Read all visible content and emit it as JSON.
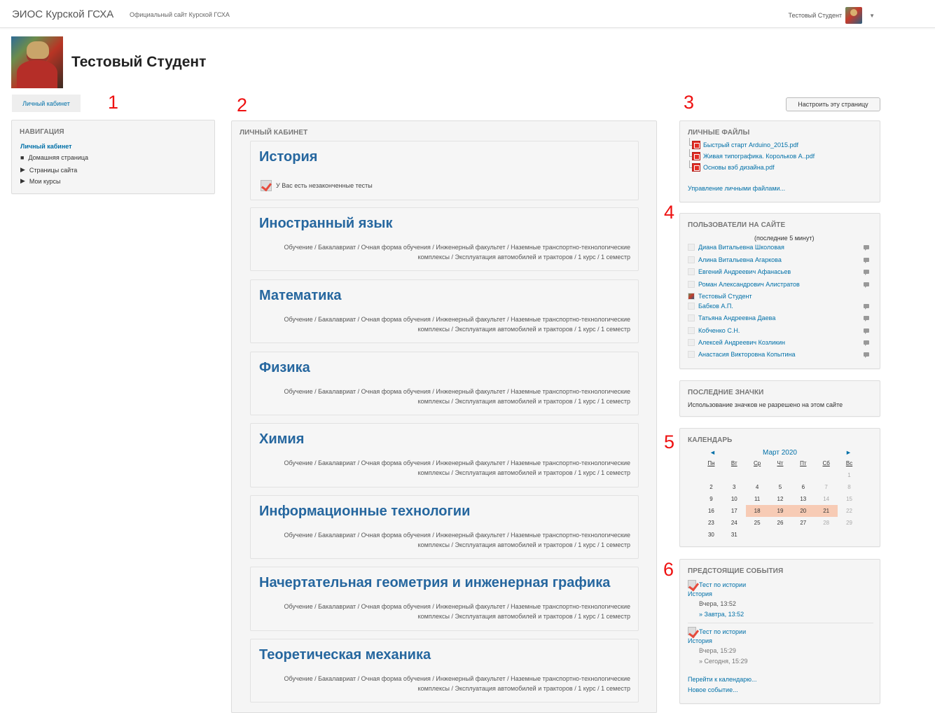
{
  "topbar": {
    "brand": "ЭИОС Курской ГСХА",
    "official_link": "Официальный сайт Курской ГСХА",
    "user_name": "Тестовый Студент"
  },
  "profile": {
    "name": "Тестовый Студент"
  },
  "markers": [
    "1",
    "2",
    "3",
    "4",
    "5",
    "6"
  ],
  "left": {
    "dashboard_tab": "Личный кабинет",
    "navigation": {
      "title": "НАВИГАЦИЯ",
      "items": [
        "Личный кабинет",
        "Домашняя страница",
        "Страницы сайта",
        "Мои курсы"
      ]
    }
  },
  "main": {
    "title": "ЛИЧНЫЙ КАБИНЕТ",
    "courses": [
      {
        "title": "История",
        "note": "У Вас есть незаконченные тесты",
        "path": ""
      },
      {
        "title": "Иностранный язык",
        "note": "",
        "path": "Обучение / Бакалавриат / Очная форма обучения / Инженерный факультет / Наземные транспортно-технологические комплексы / Эксплуатация автомобилей и тракторов / 1 курс / 1 семестр"
      },
      {
        "title": "Математика",
        "note": "",
        "path": "Обучение / Бакалавриат / Очная форма обучения / Инженерный факультет / Наземные транспортно-технологические комплексы / Эксплуатация автомобилей и тракторов / 1 курс / 1 семестр"
      },
      {
        "title": "Физика",
        "note": "",
        "path": "Обучение / Бакалавриат / Очная форма обучения / Инженерный факультет / Наземные транспортно-технологические комплексы / Эксплуатация автомобилей и тракторов / 1 курс / 1 семестр"
      },
      {
        "title": "Химия",
        "note": "",
        "path": "Обучение / Бакалавриат / Очная форма обучения / Инженерный факультет / Наземные транспортно-технологические комплексы / Эксплуатация автомобилей и тракторов / 1 курс / 1 семестр"
      },
      {
        "title": "Информационные технологии",
        "note": "",
        "path": "Обучение / Бакалавриат / Очная форма обучения / Инженерный факультет / Наземные транспортно-технологические комплексы / Эксплуатация автомобилей и тракторов / 1 курс / 1 семестр"
      },
      {
        "title": "Начертательная геометрия и инженерная графика",
        "note": "",
        "path": "Обучение / Бакалавриат / Очная форма обучения / Инженерный факультет / Наземные транспортно-технологические комплексы / Эксплуатация автомобилей и тракторов / 1 курс / 1 семестр"
      },
      {
        "title": "Теоретическая механика",
        "note": "",
        "path": "Обучение / Бакалавриат / Очная форма обучения / Инженерный факультет / Наземные транспортно-технологические комплексы / Эксплуатация автомобилей и тракторов / 1 курс / 1 семестр"
      }
    ]
  },
  "right": {
    "customize_button": "Настроить эту страницу",
    "private_files": {
      "title": "ЛИЧНЫЕ ФАЙЛЫ",
      "files": [
        "Быстрый старт Arduino_2015.pdf",
        "Живая типографика. Корольков А..pdf",
        "Основы вэб дизайна.pdf"
      ],
      "manage": "Управление личными файлами..."
    },
    "online_users": {
      "title": "ПОЛЬЗОВАТЕЛИ НА САЙТЕ",
      "period": "(последние 5 минут)",
      "users": [
        "Диана Витальевна Школовая",
        "Алина Витальевна Агаркова",
        "Евгений Андреевич Афанасьев",
        "Роман Александрович Алистратов",
        "Тестовый Студент",
        "Бабков А.П.",
        "Татьяна Андреевна Даева",
        "Кобченко С.Н.",
        "Алексей Андреевич Козликин",
        "Анастасия Викторовна Копытина"
      ]
    },
    "badges": {
      "title": "ПОСЛЕДНИЕ ЗНАЧКИ",
      "text": "Использование значков не разрешено на этом сайте"
    },
    "calendar": {
      "title": "КАЛЕНДАРЬ",
      "prev": "◄",
      "next": "►",
      "month": "Март 2020",
      "days": [
        "Пн",
        "Вт",
        "Ср",
        "Чт",
        "Пт",
        "Сб",
        "Вс"
      ],
      "weeks": [
        [
          "",
          "",
          "",
          "",
          "",
          "",
          "1"
        ],
        [
          "2",
          "3",
          "4",
          "5",
          "6",
          "7",
          "8"
        ],
        [
          "9",
          "10",
          "11",
          "12",
          "13",
          "14",
          "15"
        ],
        [
          "16",
          "17",
          "18",
          "19",
          "20",
          "21",
          "22"
        ],
        [
          "23",
          "24",
          "25",
          "26",
          "27",
          "28",
          "29"
        ],
        [
          "30",
          "31",
          "",
          "",
          "",
          "",
          ""
        ]
      ],
      "highlight_days": [
        "18",
        "19",
        "20",
        "21"
      ],
      "highlight_color": "#f7cbb5"
    },
    "events": {
      "title": "ПРЕДСТОЯЩИЕ СОБЫТИЯ",
      "items": [
        {
          "name": "Тест по истории",
          "course": "История",
          "start": "Вчера, 13:52",
          "end": "» Завтра, 13:52"
        },
        {
          "name": "Тест по истории",
          "course": "История",
          "start": "Вчера, 15:29",
          "end": "» Сегодня, 15:29"
        }
      ],
      "goto_calendar": "Перейти к календарю...",
      "new_event": "Новое событие..."
    }
  }
}
